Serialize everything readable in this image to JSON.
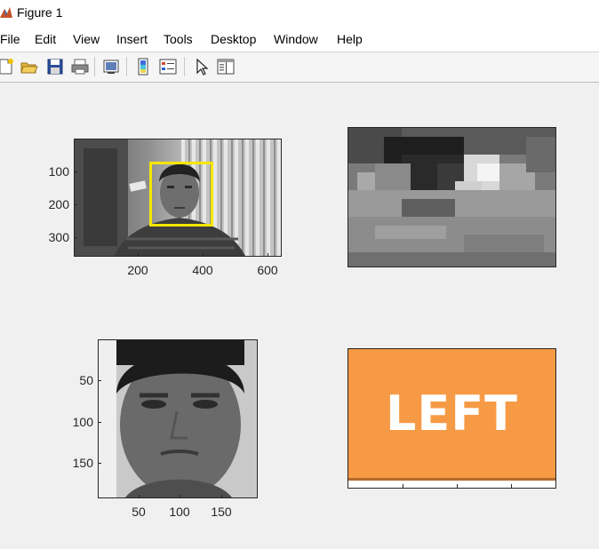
{
  "window": {
    "title": "Figure 1",
    "app_icon": "matlab-icon"
  },
  "menu": [
    {
      "label": "File"
    },
    {
      "label": "Edit"
    },
    {
      "label": "View"
    },
    {
      "label": "Insert"
    },
    {
      "label": "Tools"
    },
    {
      "label": "Desktop"
    },
    {
      "label": "Window"
    },
    {
      "label": "Help"
    }
  ],
  "toolbar": [
    "new-figure-icon",
    "open-file-icon",
    "save-icon",
    "print-icon",
    "link-plot-icon",
    "insert-colorbar-icon",
    "insert-legend-icon",
    "edit-plot-arrow-icon",
    "property-inspector-icon"
  ],
  "plots": {
    "camera_frame": {
      "y_ticks": [
        "100",
        "200",
        "300"
      ],
      "x_ticks": [
        "200",
        "400",
        "600"
      ],
      "face_box_color": "#f5e600"
    },
    "eye_crop": {},
    "face_crop": {
      "y_ticks": [
        "50",
        "100",
        "150"
      ],
      "x_ticks": [
        "50",
        "100",
        "150"
      ]
    },
    "direction_panel": {
      "label": "LEFT",
      "background": "#f79a46",
      "text_color": "#ffffff"
    }
  }
}
